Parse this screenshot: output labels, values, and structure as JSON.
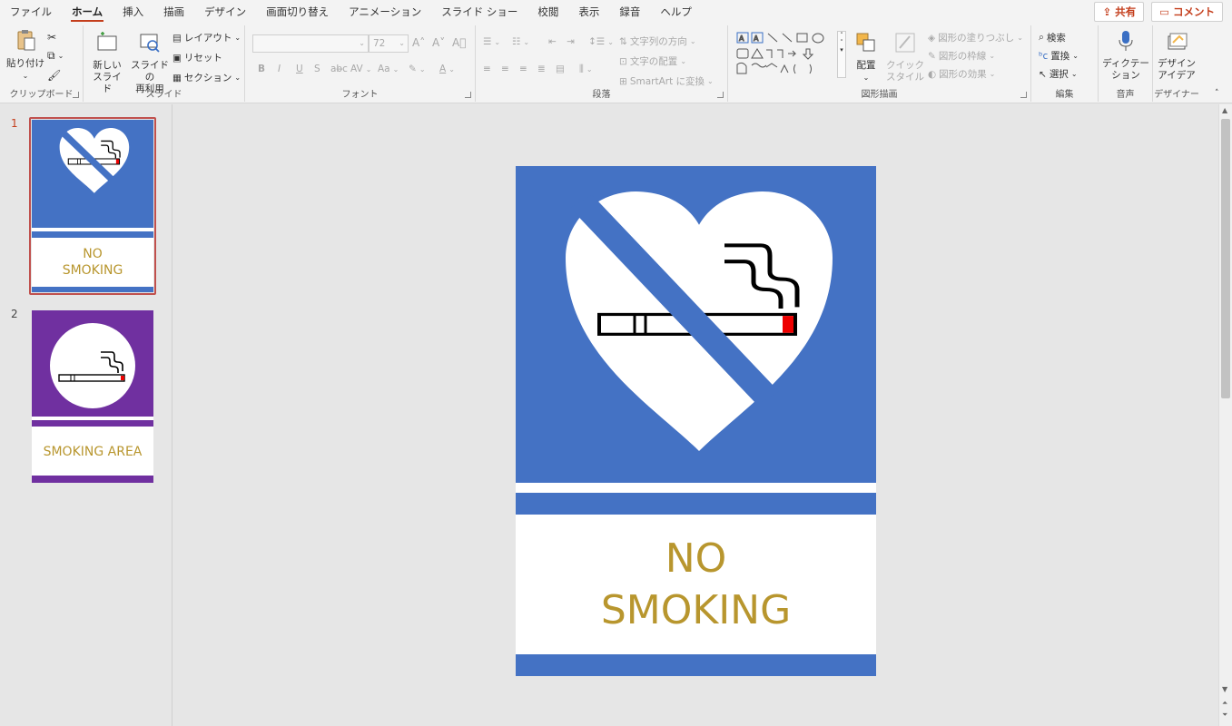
{
  "menu": {
    "tabs": [
      "ファイル",
      "ホーム",
      "挿入",
      "描画",
      "デザイン",
      "画面切り替え",
      "アニメーション",
      "スライド ショー",
      "校閲",
      "表示",
      "録音",
      "ヘルプ"
    ],
    "active_tab": "ホーム",
    "share_label": "共有",
    "comment_label": "コメント"
  },
  "ribbon": {
    "clipboard": {
      "paste": "貼り付け",
      "label": "クリップボード"
    },
    "slides": {
      "new_slide_line1": "新しい",
      "new_slide_line2": "スライド",
      "reuse_line1": "スライドの",
      "reuse_line2": "再利用",
      "layout": "レイアウト",
      "reset": "リセット",
      "section": "セクション",
      "label": "スライド"
    },
    "font": {
      "size": "72",
      "bold": "B",
      "italic": "I",
      "underline": "U",
      "strike": "S",
      "label": "フォント"
    },
    "paragraph": {
      "text_direction": "文字列の方向",
      "align_text": "文字の配置",
      "smartart": "SmartArt に変換",
      "label": "段落"
    },
    "drawing": {
      "arrange": "配置",
      "quick_style_line1": "クイック",
      "quick_style_line2": "スタイル",
      "shape_fill": "図形の塗りつぶし",
      "shape_outline": "図形の枠線",
      "shape_effects": "図形の効果",
      "label": "図形描画"
    },
    "editing": {
      "find": "検索",
      "replace": "置換",
      "select": "選択",
      "label": "編集"
    },
    "voice": {
      "dictate_line1": "ディクテー",
      "dictate_line2": "ション",
      "label": "音声"
    },
    "designer": {
      "ideas_line1": "デザイン",
      "ideas_line2": "アイデア",
      "label": "デザイナー"
    }
  },
  "slides_panel": {
    "items": [
      {
        "number": "1",
        "line1": "NO",
        "line2": "SMOKING"
      },
      {
        "number": "2",
        "line1": "SMOKING AREA"
      }
    ]
  },
  "current_slide": {
    "title_line1": "NO",
    "title_line2": "SMOKING"
  },
  "colors": {
    "accent": "#c43e1c",
    "slide1_bg": "#4472c4",
    "slide2_bg": "#7030a0",
    "text_gold": "#b8962e"
  }
}
